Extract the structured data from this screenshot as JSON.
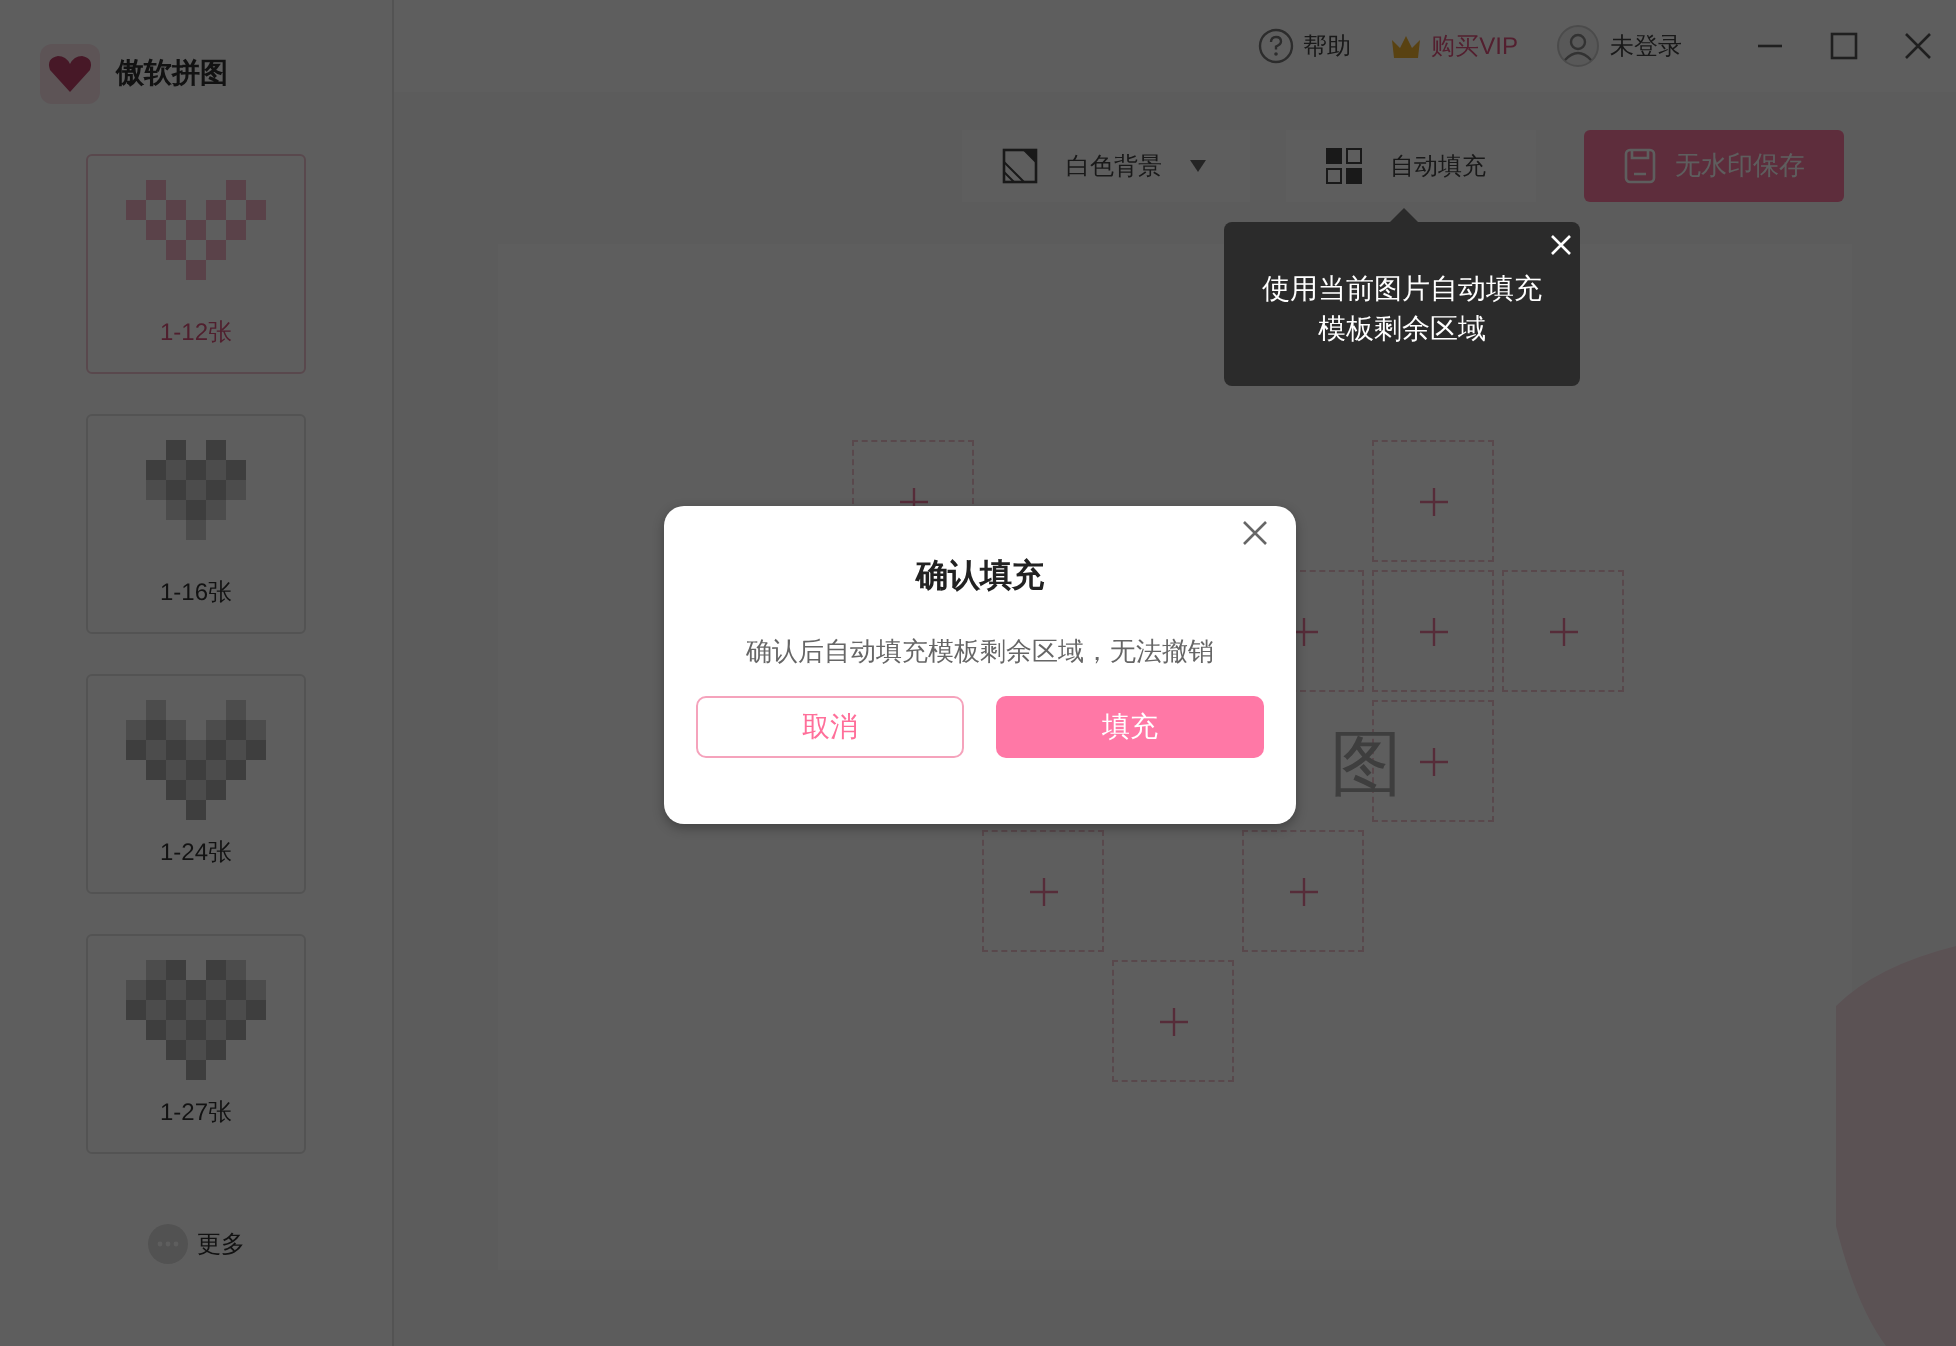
{
  "app": {
    "name": "傲软拼图"
  },
  "titlebar": {
    "help": "帮助",
    "vip": "购买VIP",
    "user": "未登录"
  },
  "templates": [
    {
      "label": "1-12张",
      "selected": true
    },
    {
      "label": "1-16张",
      "selected": false
    },
    {
      "label": "1-24张",
      "selected": false
    },
    {
      "label": "1-27张",
      "selected": false
    }
  ],
  "more": "更多",
  "toolbar": {
    "background": "白色背景",
    "autofill": "自动填充",
    "save": "无水印保存"
  },
  "tooltip": {
    "text": "使用当前图片自动填充模板剩余区域"
  },
  "canvas": {
    "watermark": "图"
  },
  "dialog": {
    "title": "确认填充",
    "message": "确认后自动填充模板剩余区域，无法撤销",
    "buttons": [
      {
        "label": "取消",
        "kind": "secondary"
      },
      {
        "label": "填充",
        "kind": "primary"
      }
    ]
  }
}
